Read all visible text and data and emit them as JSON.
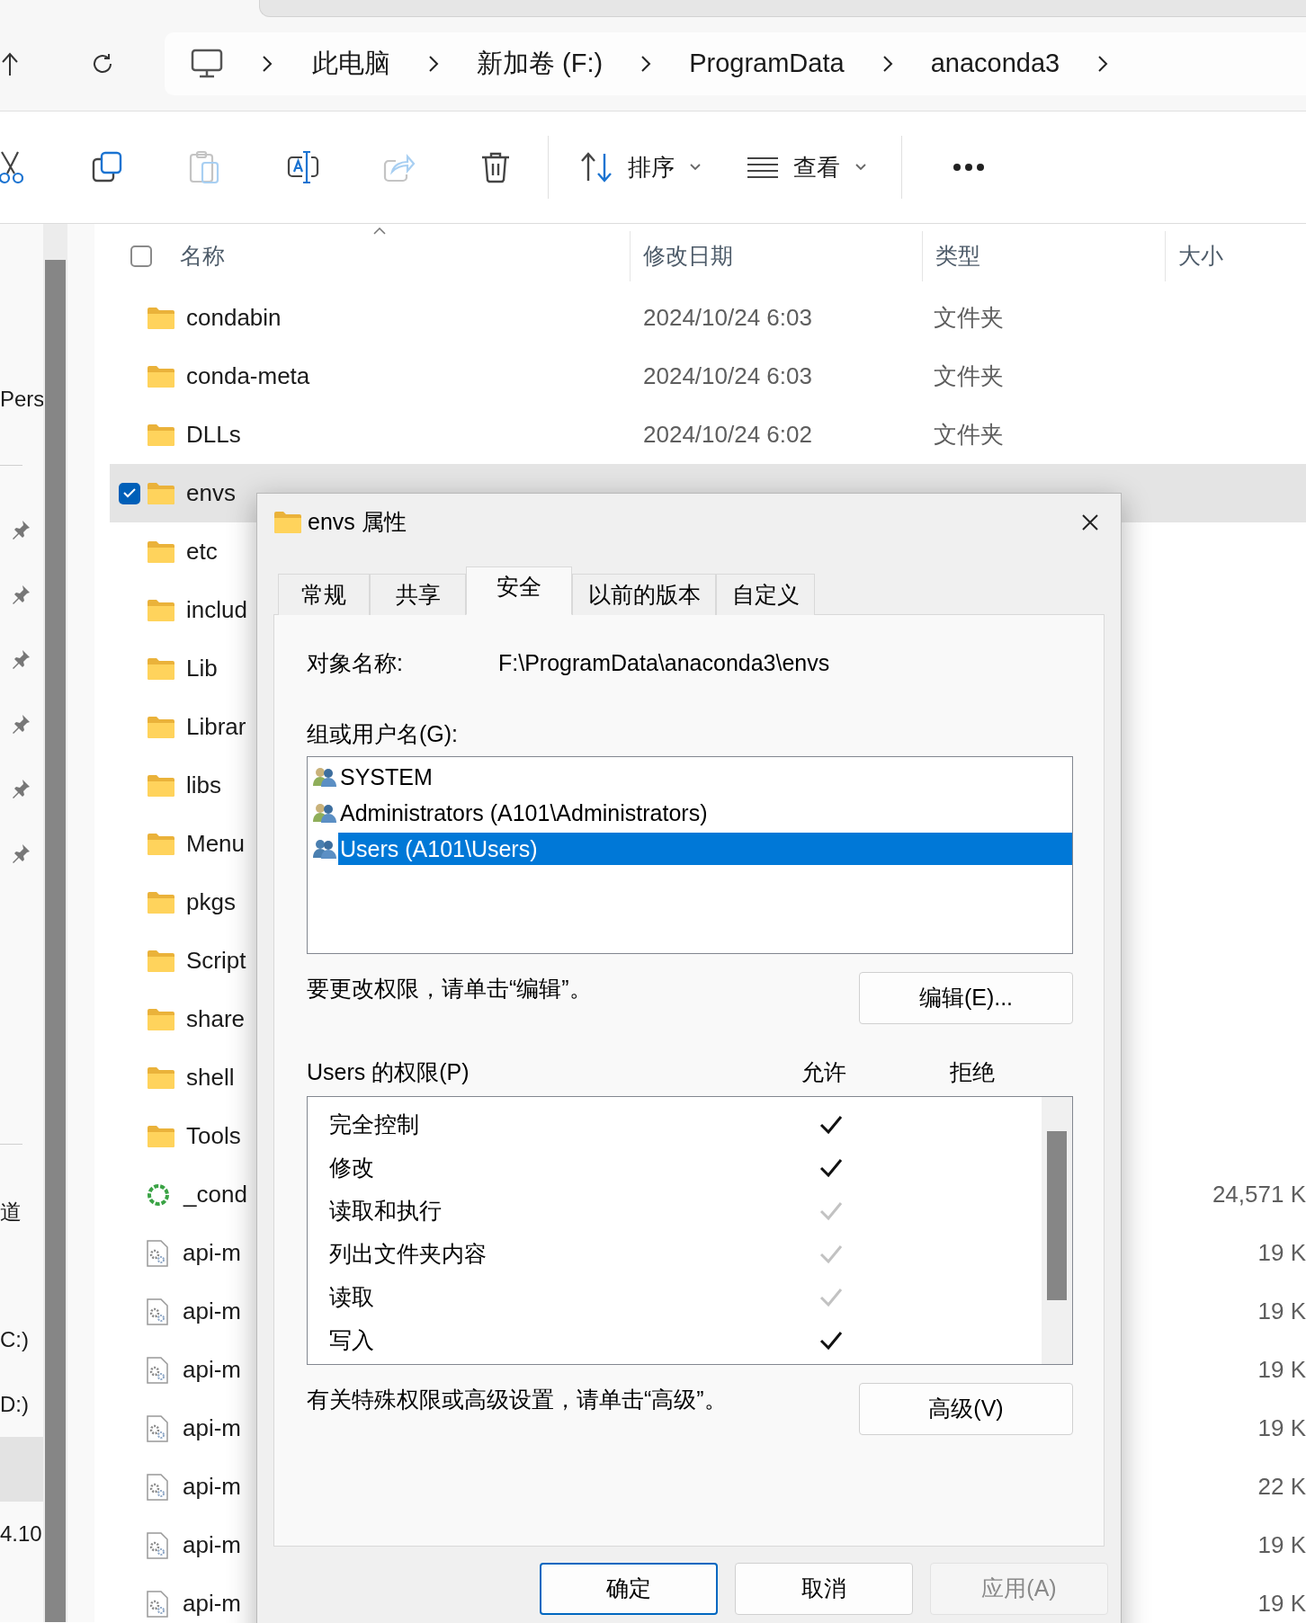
{
  "address_bar": {
    "breadcrumb": [
      "此电脑",
      "新加卷 (F:)",
      "ProgramData",
      "anaconda3"
    ]
  },
  "toolbar": {
    "sort": "排序",
    "view": "查看"
  },
  "nav_pane": {
    "top_label": "Pers",
    "group_label": "道",
    "drives": [
      {
        "label": "C:)",
        "selected": false
      },
      {
        "label": "D:)",
        "selected": false
      },
      {
        "selected": true
      },
      {
        "label": "4.10",
        "selected": false
      }
    ]
  },
  "file_list": {
    "columns": [
      "名称",
      "修改日期",
      "类型",
      "大小"
    ],
    "select_all_checked": false,
    "rows": [
      {
        "name": "condabin",
        "kind": "folder",
        "date": "2024/10/24 6:03",
        "type": "文件夹",
        "selected": false
      },
      {
        "name": "conda-meta",
        "kind": "folder",
        "date": "2024/10/24 6:03",
        "type": "文件夹",
        "selected": false
      },
      {
        "name": "DLLs",
        "kind": "folder",
        "date": "2024/10/24 6:02",
        "type": "文件夹",
        "selected": false
      },
      {
        "name": "envs",
        "kind": "folder",
        "selected": true
      },
      {
        "name": "etc",
        "kind": "folder",
        "selected": false
      },
      {
        "name": "includ",
        "kind": "folder",
        "selected": false
      },
      {
        "name": "Lib",
        "kind": "folder",
        "selected": false
      },
      {
        "name": "Librar",
        "kind": "folder",
        "selected": false
      },
      {
        "name": "libs",
        "kind": "folder",
        "selected": false
      },
      {
        "name": "Menu",
        "kind": "folder",
        "selected": false
      },
      {
        "name": "pkgs",
        "kind": "folder",
        "selected": false
      },
      {
        "name": "Script",
        "kind": "folder",
        "selected": false
      },
      {
        "name": "share",
        "kind": "folder",
        "selected": false
      },
      {
        "name": "shell",
        "kind": "folder",
        "selected": false
      },
      {
        "name": "Tools",
        "kind": "folder",
        "selected": false
      },
      {
        "name": "_cond",
        "kind": "installer",
        "size": "24,571 K",
        "selected": false
      },
      {
        "name": "api-m",
        "kind": "dll",
        "size": "19 K",
        "selected": false
      },
      {
        "name": "api-m",
        "kind": "dll",
        "size": "19 K",
        "selected": false
      },
      {
        "name": "api-m",
        "kind": "dll",
        "size": "19 K",
        "selected": false
      },
      {
        "name": "api-m",
        "kind": "dll",
        "size": "19 K",
        "selected": false
      },
      {
        "name": "api-m",
        "kind": "dll",
        "size": "22 K",
        "selected": false
      },
      {
        "name": "api-m",
        "kind": "dll",
        "size": "19 K",
        "selected": false
      },
      {
        "name": "api-m",
        "kind": "dll",
        "size": "19 K",
        "selected": false
      }
    ]
  },
  "dialog": {
    "title": "envs 属性",
    "tabs": [
      {
        "label": "常规",
        "selected": false
      },
      {
        "label": "共享",
        "selected": false
      },
      {
        "label": "安全",
        "selected": true
      },
      {
        "label": "以前的版本",
        "selected": false
      },
      {
        "label": "自定义",
        "selected": false
      }
    ],
    "object_label": "对象名称:",
    "object_value": "F:\\ProgramData\\anaconda3\\envs",
    "groups_label": "组或用户名(G):",
    "principals": [
      {
        "name": "SYSTEM",
        "selected": false
      },
      {
        "name": "Administrators (A101\\Administrators)",
        "selected": false
      },
      {
        "name": "Users (A101\\Users)",
        "selected": true
      }
    ],
    "edit_hint": "要更改权限，请单击“编辑”。",
    "edit_button": "编辑(E)...",
    "permissions_label": "Users 的权限(P)",
    "allow_header": "允许",
    "deny_header": "拒绝",
    "permissions": [
      {
        "name": "完全控制",
        "allow": true,
        "disabled": false
      },
      {
        "name": "修改",
        "allow": true,
        "disabled": false
      },
      {
        "name": "读取和执行",
        "allow": true,
        "disabled": true
      },
      {
        "name": "列出文件夹内容",
        "allow": true,
        "disabled": true
      },
      {
        "name": "读取",
        "allow": true,
        "disabled": true
      },
      {
        "name": "写入",
        "allow": true,
        "disabled": false
      }
    ],
    "advanced_hint": "有关特殊权限或高级设置，请单击“高级”。",
    "advanced_button": "高级(V)",
    "buttons": [
      {
        "label": "确定",
        "kind": "default"
      },
      {
        "label": "取消",
        "kind": "normal"
      },
      {
        "label": "应用(A)",
        "kind": "disabled"
      }
    ]
  }
}
